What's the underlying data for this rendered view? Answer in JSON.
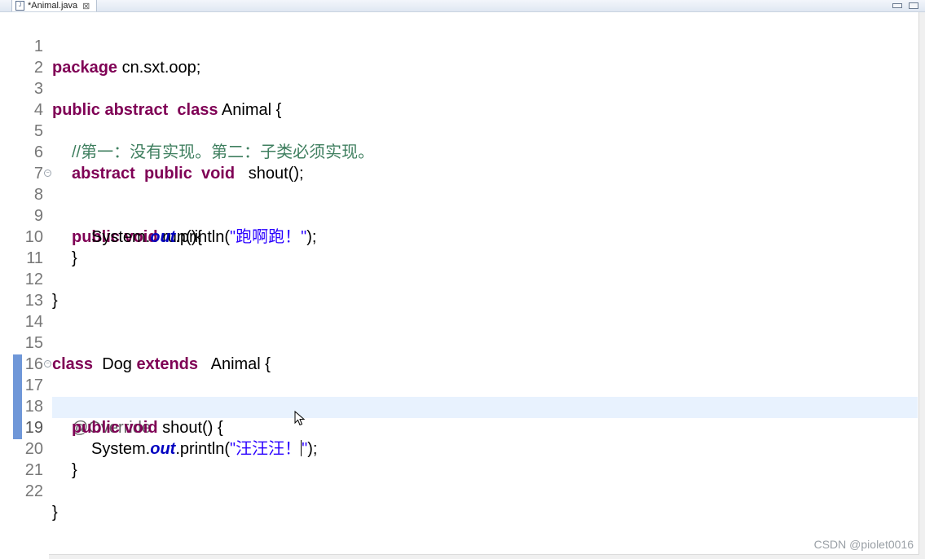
{
  "tab": {
    "label": "*Animal.java",
    "close": "⊠"
  },
  "lines": [
    {
      "num": "1",
      "code": "package cn.sxt.oop;"
    },
    {
      "num": "2",
      "code": ""
    },
    {
      "num": "3",
      "code": "public abstract  class Animal {"
    },
    {
      "num": "4",
      "code": ""
    },
    {
      "num": "5",
      "code": "    //第一：没有实现。第二：子类必须实现。"
    },
    {
      "num": "6",
      "code": "    abstract  public  void   shout();"
    },
    {
      "num": "7",
      "code": ""
    },
    {
      "num": "8",
      "code": "    public void run(){"
    },
    {
      "num": "9",
      "code": "        System.out.println(\"跑啊跑！\");"
    },
    {
      "num": "10",
      "code": "    }"
    },
    {
      "num": "11",
      "code": ""
    },
    {
      "num": "12",
      "code": "}"
    },
    {
      "num": "13",
      "code": ""
    },
    {
      "num": "14",
      "code": ""
    },
    {
      "num": "15",
      "code": "class  Dog extends   Animal {"
    },
    {
      "num": "16",
      "code": ""
    },
    {
      "num": "17",
      "code": "    @Override"
    },
    {
      "num": "18",
      "code": "    public void shout() {"
    },
    {
      "num": "19",
      "code": "        System.out.println(\"汪汪汪！\");"
    },
    {
      "num": "20",
      "code": "    }"
    },
    {
      "num": "21",
      "code": ""
    },
    {
      "num": "22",
      "code": "}"
    }
  ],
  "tokens": {
    "l1_kw": "package",
    "l1_rest": " cn.sxt.oop;",
    "l3_kw1": "public",
    "l3_kw2": "abstract",
    "l3_kw3": "class",
    "l3_rest": " Animal {",
    "l5_comment": "//第一：没有实现。第二：子类必须实现。",
    "l6_kw1": "abstract",
    "l6_kw2": "public",
    "l6_kw3": "void",
    "l6_rest": "shout();",
    "l8_kw1": "public",
    "l8_kw2": "void",
    "l8_rest": " run(){",
    "l9_pre": "System.",
    "l9_field": "out",
    "l9_mid": ".println(",
    "l9_str": "\"跑啊跑！\"",
    "l9_end": ");",
    "l10": "}",
    "l12": "}",
    "l15_kw1": "class",
    "l15_mid": "Dog ",
    "l15_kw2": "extends",
    "l15_rest": "Animal {",
    "l17_ann": "@Override",
    "l18_kw1": "public",
    "l18_kw2": "void",
    "l18_rest": " shout() {",
    "l19_pre": "System.",
    "l19_field": "out",
    "l19_mid": ".println(",
    "l19_str1": "\"汪汪汪！",
    "l19_str2": "\"",
    "l19_end": ");",
    "l20": "}",
    "l22": "}"
  },
  "watermark": "CSDN @piolet0016",
  "colors": {
    "keyword": "#7f0055",
    "comment": "#3f7f5f",
    "string": "#2a00ff",
    "field": "#0000c0",
    "annotation": "#646464",
    "current_line": "#e8f2fe"
  }
}
